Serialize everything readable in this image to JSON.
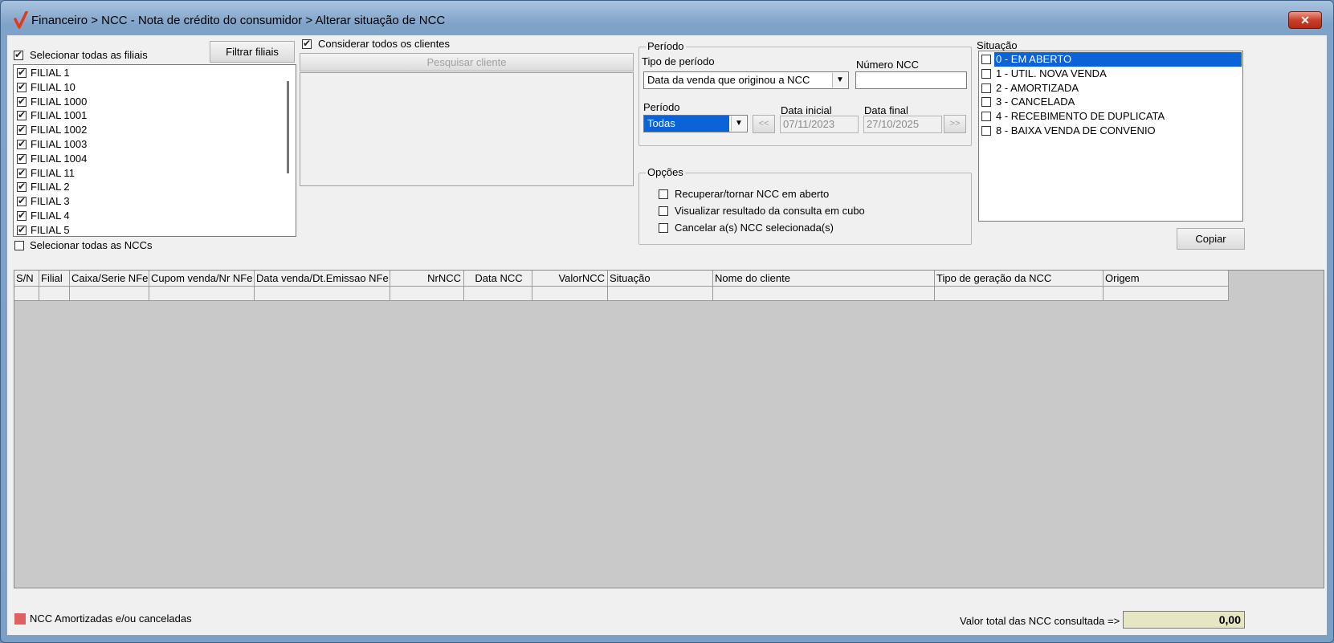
{
  "window": {
    "title": "Financeiro > NCC - Nota de crédito do consumidor > Alterar situação de NCC",
    "close_label": "✕",
    "accent_color": "#e03a1e"
  },
  "filiais": {
    "select_all_label": "Selecionar todas as filiais",
    "select_all_checked": true,
    "filter_button": "Filtrar filiais",
    "items": [
      {
        "label": "FILIAL 1",
        "checked": true
      },
      {
        "label": "FILIAL 10",
        "checked": true
      },
      {
        "label": "FILIAL 1000",
        "checked": true
      },
      {
        "label": "FILIAL 1001",
        "checked": true
      },
      {
        "label": "FILIAL 1002",
        "checked": true
      },
      {
        "label": "FILIAL 1003",
        "checked": true
      },
      {
        "label": "FILIAL 1004",
        "checked": true
      },
      {
        "label": "FILIAL 11",
        "checked": true
      },
      {
        "label": "FILIAL 2",
        "checked": true
      },
      {
        "label": "FILIAL 3",
        "checked": true
      },
      {
        "label": "FILIAL 4",
        "checked": true
      },
      {
        "label": "FILIAL 5",
        "checked": true
      }
    ]
  },
  "clientes": {
    "consider_all_label": "Considerar todos os clientes",
    "consider_all_checked": true,
    "search_button": "Pesquisar cliente"
  },
  "periodo": {
    "group_title": "Período",
    "tipo_label": "Tipo de período",
    "tipo_value": "Data da venda que originou a NCC",
    "numero_label": "Número NCC",
    "numero_value": "",
    "periodo_label": "Período",
    "periodo_value": "Todas",
    "prev_button": "<<",
    "next_button": ">>",
    "data_inicial_label": "Data inicial",
    "data_inicial_value": "07/11/2023",
    "data_final_label": "Data final",
    "data_final_value": "27/10/2025"
  },
  "opcoes": {
    "group_title": "Opções",
    "items": [
      {
        "label": "Recuperar/tornar NCC em aberto",
        "checked": false
      },
      {
        "label": "Visualizar resultado da consulta em cubo",
        "checked": false
      },
      {
        "label": "Cancelar a(s) NCC selecionada(s)",
        "checked": false
      }
    ]
  },
  "situacao": {
    "label": "Situação",
    "items": [
      {
        "label": "0 - EM ABERTO",
        "checked": false,
        "selected": true
      },
      {
        "label": "1 - UTIL. NOVA VENDA",
        "checked": false,
        "selected": false
      },
      {
        "label": "2 - AMORTIZADA",
        "checked": false,
        "selected": false
      },
      {
        "label": "3 - CANCELADA",
        "checked": false,
        "selected": false
      },
      {
        "label": "4 - RECEBIMENTO DE DUPLICATA",
        "checked": false,
        "selected": false
      },
      {
        "label": "8 - BAIXA VENDA DE CONVENIO",
        "checked": false,
        "selected": false
      }
    ]
  },
  "toolbar": {
    "copiar_button": "Copiar",
    "select_all_ncc_label": "Selecionar todas as NCCs",
    "select_all_ncc_checked": false
  },
  "grid": {
    "columns": [
      {
        "label": "S/N",
        "align": "left"
      },
      {
        "label": "Filial",
        "align": "left"
      },
      {
        "label": "Caixa/Serie NFe",
        "align": "left"
      },
      {
        "label": "Cupom venda/Nr NFe",
        "align": "left"
      },
      {
        "label": "Data venda/Dt.Emissao NFe",
        "align": "left"
      },
      {
        "label": "NrNCC",
        "align": "right"
      },
      {
        "label": "Data NCC",
        "align": "center"
      },
      {
        "label": "ValorNCC",
        "align": "right"
      },
      {
        "label": "Situação",
        "align": "left"
      },
      {
        "label": "Nome do cliente",
        "align": "left"
      },
      {
        "label": "Tipo de geração da NCC",
        "align": "left"
      },
      {
        "label": "Origem",
        "align": "left"
      }
    ]
  },
  "footer": {
    "legend_label": "NCC Amortizadas e/ou canceladas",
    "legend_color": "#e06060",
    "total_label": "Valor total das NCC consultada =>",
    "total_value": "0,00",
    "total_bg": "#e6e6c2"
  }
}
